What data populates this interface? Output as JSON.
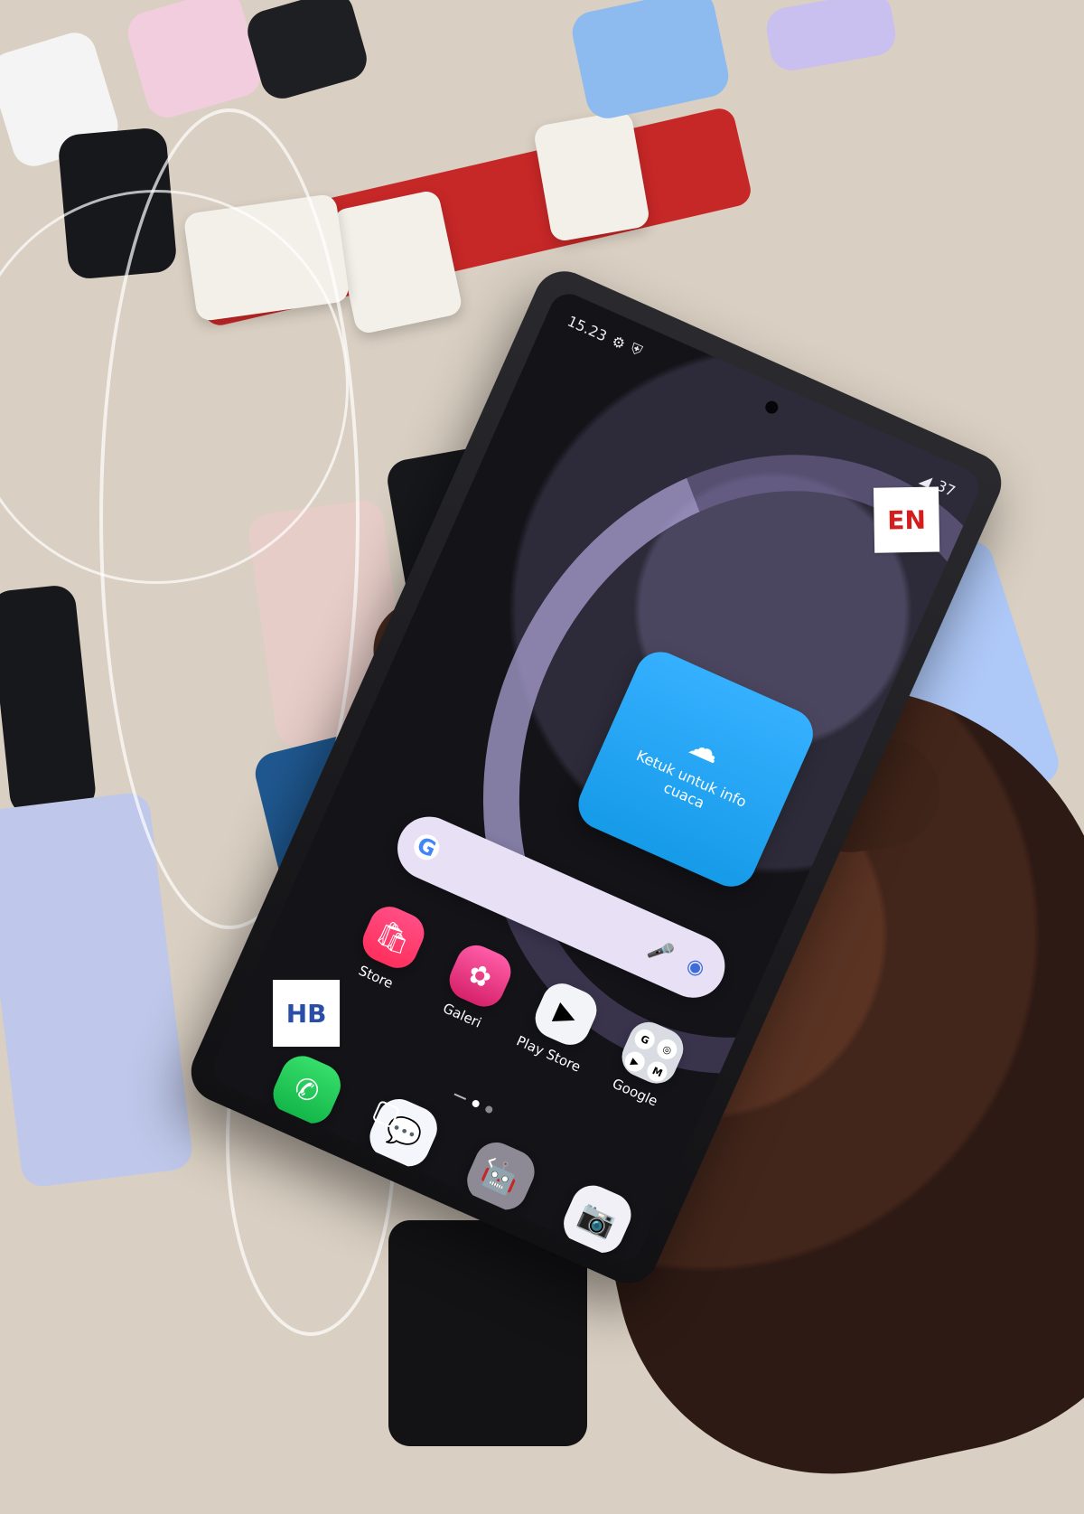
{
  "status": {
    "time": "15.23",
    "icons": [
      "gear-icon",
      "shield-icon"
    ],
    "battery": "37"
  },
  "weather_widget": {
    "text": "Ketuk untuk info cuaca"
  },
  "search": {
    "logo": "G"
  },
  "apps": [
    {
      "label": "Store",
      "icon": "store-icon"
    },
    {
      "label": "Galeri",
      "icon": "gallery-icon"
    },
    {
      "label": "Play Store",
      "icon": "play-store-icon"
    },
    {
      "label": "Google",
      "icon": "google-folder-icon"
    }
  ],
  "dock": [
    {
      "icon": "phone-icon"
    },
    {
      "icon": "messages-icon"
    },
    {
      "icon": "android-icon"
    },
    {
      "icon": "camera-icon"
    }
  ],
  "stickers": {
    "top": "EN",
    "bottom": "HB"
  }
}
